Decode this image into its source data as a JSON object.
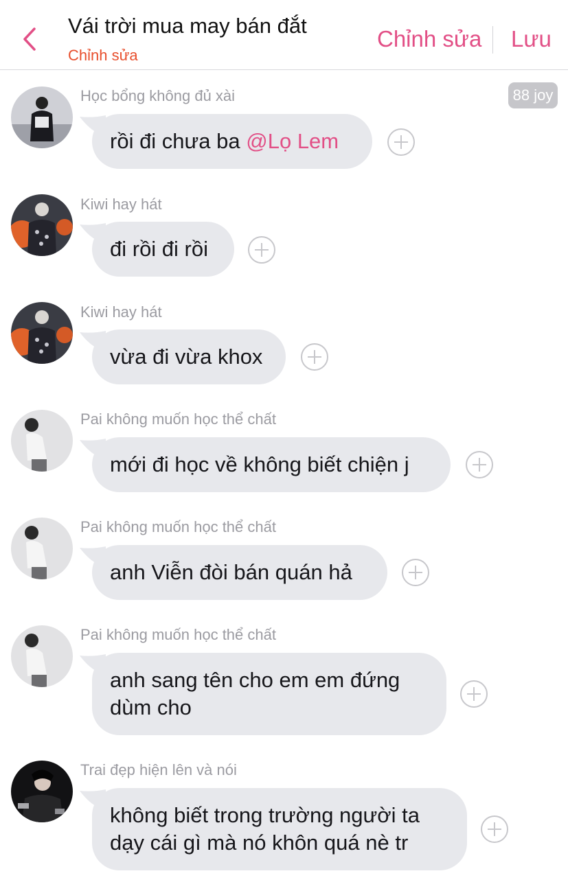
{
  "header": {
    "title": "Vái trời mua may bán đắt",
    "subtitle": "Chỉnh sửa",
    "edit_label": "Chỉnh sửa",
    "save_label": "Lưu"
  },
  "joy_badge": "88 joy",
  "messages": [
    {
      "sender": "Học bổng không đủ xài",
      "text": "rồi đi chưa ba ",
      "mention": "@Lọ Lem"
    },
    {
      "sender": "Kiwi hay hát",
      "text": "đi rồi đi rồi"
    },
    {
      "sender": "Kiwi hay hát",
      "text": "vừa đi vừa khox"
    },
    {
      "sender": "Pai không muốn học thể chất",
      "text": "mới đi học về không biết chiện j"
    },
    {
      "sender": "Pai không muốn học thể chất",
      "text": "anh Viễn đòi bán quán hả"
    },
    {
      "sender": "Pai không muốn học thể chất",
      "text_line1": "anh sang tên cho em em đứng",
      "text_line2": "dùm cho"
    },
    {
      "sender": "Trai đẹp hiện lên và nói",
      "text_line1": "không biết trong trường người ta",
      "text_line2": "dạy cái gì mà nó khôn quá nè tr"
    }
  ],
  "colors": {
    "accent": "#e24f86",
    "subtitle": "#e84f2d",
    "bubble": "#e7e8ec",
    "sender": "#9b9ba1"
  }
}
